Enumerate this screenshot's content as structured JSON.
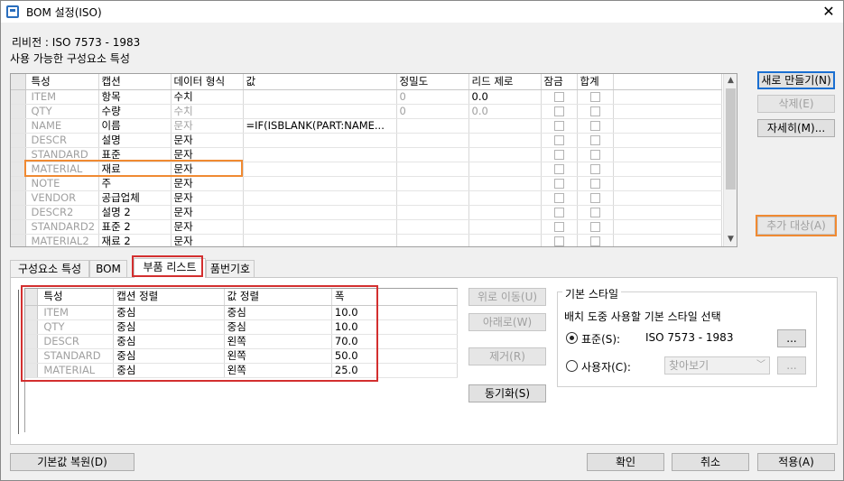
{
  "window": {
    "title": "BOM 설정(ISO)",
    "close": "✕"
  },
  "revision_label": "리비전 : ISO 7573 - 1983",
  "available_label": "사용 가능한 구성요소 특성",
  "grid": {
    "headers": [
      "특성",
      "캡션",
      "데이터 형식",
      "값",
      "정밀도",
      "리드 제로",
      "잠금",
      "합계"
    ],
    "rows": [
      {
        "prop": "ITEM",
        "caption": "항목",
        "type": "수치",
        "type_gray": false,
        "value": "",
        "precision": "0",
        "lead": "0.0",
        "lead_gray": false
      },
      {
        "prop": "QTY",
        "caption": "수량",
        "type": "수치",
        "type_gray": true,
        "value": "",
        "precision": "0",
        "lead": "0.0",
        "lead_gray": true
      },
      {
        "prop": "NAME",
        "caption": "이름",
        "type": "문자",
        "type_gray": true,
        "value": "=IF(ISBLANK(PART:NAME...",
        "precision": "",
        "lead": "",
        "lead_gray": false
      },
      {
        "prop": "DESCR",
        "caption": "설명",
        "type": "문자",
        "type_gray": false,
        "value": "",
        "precision": "",
        "lead": "",
        "lead_gray": false
      },
      {
        "prop": "STANDARD",
        "caption": "표준",
        "type": "문자",
        "type_gray": false,
        "value": "",
        "precision": "",
        "lead": "",
        "lead_gray": false
      },
      {
        "prop": "MATERIAL",
        "caption": "재료",
        "type": "문자",
        "type_gray": false,
        "value": "",
        "precision": "",
        "lead": "",
        "lead_gray": false
      },
      {
        "prop": "NOTE",
        "caption": "주",
        "type": "문자",
        "type_gray": false,
        "value": "",
        "precision": "",
        "lead": "",
        "lead_gray": false
      },
      {
        "prop": "VENDOR",
        "caption": "공급업체",
        "type": "문자",
        "type_gray": false,
        "value": "",
        "precision": "",
        "lead": "",
        "lead_gray": false
      },
      {
        "prop": "DESCR2",
        "caption": "설명 2",
        "type": "문자",
        "type_gray": false,
        "value": "",
        "precision": "",
        "lead": "",
        "lead_gray": false
      },
      {
        "prop": "STANDARD2",
        "caption": "표준 2",
        "type": "문자",
        "type_gray": false,
        "value": "",
        "precision": "",
        "lead": "",
        "lead_gray": false
      },
      {
        "prop": "MATERIAL2",
        "caption": "재료 2",
        "type": "문자",
        "type_gray": false,
        "value": "",
        "precision": "",
        "lead": "",
        "lead_gray": false
      }
    ]
  },
  "side_buttons": {
    "new": "새로 만들기(N)",
    "delete": "삭제(E)",
    "details": "자세히(M)...",
    "add_target": "추가 대상(A)"
  },
  "tabs": [
    "구성요소 특성",
    "BOM",
    "부품 리스트",
    "품번기호"
  ],
  "active_tab": "부품 리스트",
  "parts_grid": {
    "headers": [
      "특성",
      "캡션 정렬",
      "값 정렬",
      "폭"
    ],
    "rows": [
      [
        "ITEM",
        "중심",
        "중심",
        "10.0"
      ],
      [
        "QTY",
        "중심",
        "중심",
        "10.0"
      ],
      [
        "DESCR",
        "중심",
        "왼쪽",
        "70.0"
      ],
      [
        "STANDARD",
        "중심",
        "왼쪽",
        "50.0"
      ],
      [
        "MATERIAL",
        "중심",
        "왼쪽",
        "25.0"
      ]
    ]
  },
  "move_buttons": {
    "up": "위로 이동(U)",
    "down": "아래로(W)",
    "remove": "제거(R)",
    "sync": "동기화(S)"
  },
  "style_group": {
    "title": "기본 스타일",
    "desc": "배치 도중 사용할 기본 스타일 선택",
    "standard_label": "표준(S):",
    "standard_value": "ISO 7573 - 1983",
    "user_label": "사용자(C):",
    "browse_placeholder": "찾아보기",
    "ellipsis": "..."
  },
  "footer": {
    "restore": "기본값 복원(D)",
    "ok": "확인",
    "cancel": "취소",
    "apply": "적용(A)"
  },
  "colors": {
    "highlight_orange": "#f08a32",
    "highlight_red": "#d32f2f",
    "accent": "#1a6fd1"
  }
}
